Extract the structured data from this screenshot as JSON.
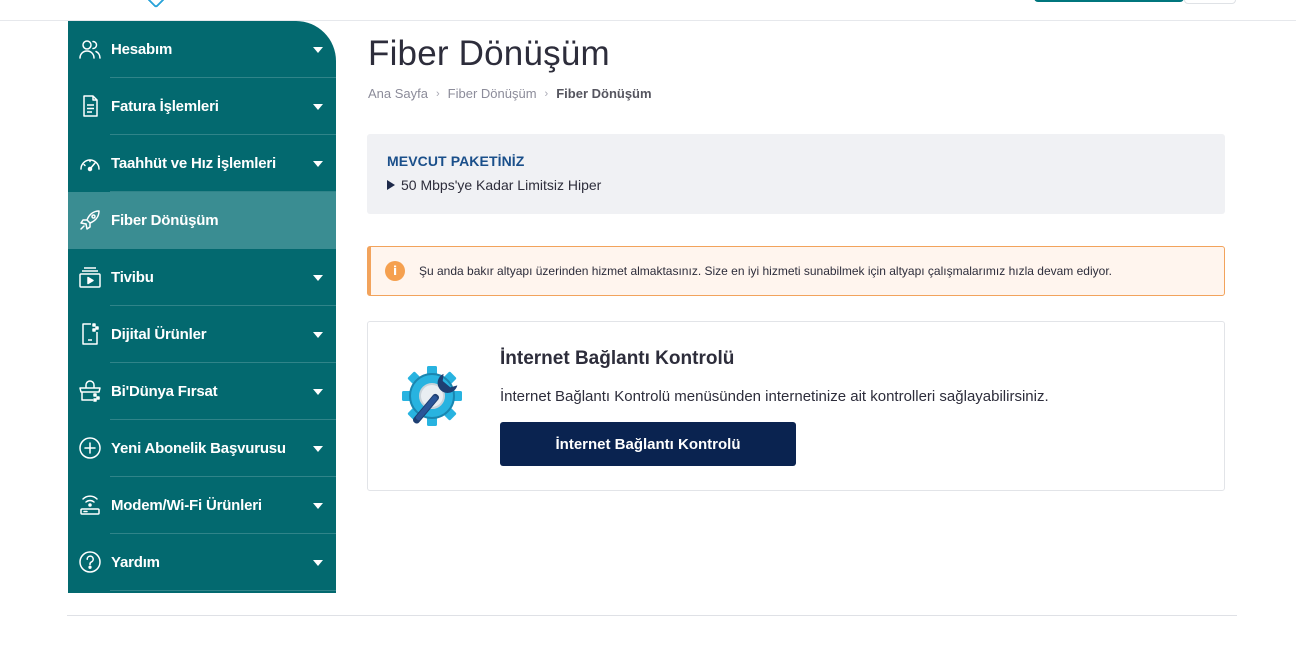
{
  "sidebar": {
    "items": [
      {
        "label": "Hesabım",
        "icon": "users-icon",
        "has_submenu": true
      },
      {
        "label": "Fatura İşlemleri",
        "icon": "document-icon",
        "has_submenu": true
      },
      {
        "label": "Taahhüt ve Hız İşlemleri",
        "icon": "speedometer-icon",
        "has_submenu": true
      },
      {
        "label": "Fiber Dönüşüm",
        "icon": "rocket-icon",
        "has_submenu": false,
        "active": true
      },
      {
        "label": "Tivibu",
        "icon": "tv-play-icon",
        "has_submenu": true
      },
      {
        "label": "Dijital Ürünler",
        "icon": "digital-device-icon",
        "has_submenu": true
      },
      {
        "label": "Bi'Dünya Fırsat",
        "icon": "shopping-basket-icon",
        "has_submenu": true
      },
      {
        "label": "Yeni Abonelik Başvurusu",
        "icon": "plus-circle-icon",
        "has_submenu": true
      },
      {
        "label": "Modem/Wi-Fi Ürünleri",
        "icon": "wifi-router-icon",
        "has_submenu": true
      },
      {
        "label": "Yardım",
        "icon": "question-circle-icon",
        "has_submenu": true
      }
    ]
  },
  "page": {
    "title": "Fiber Dönüşüm"
  },
  "breadcrumb": {
    "items": [
      "Ana Sayfa",
      "Fiber Dönüşüm",
      "Fiber Dönüşüm"
    ]
  },
  "package": {
    "title": "MEVCUT PAKETİNİZ",
    "name": "50 Mbps'ye Kadar Limitsiz Hiper"
  },
  "alert": {
    "icon_glyph": "i",
    "text": "Şu anda bakır altyapı üzerinden hizmet almaktasınız. Size en iyi hizmeti sunabilmek için altyapı çalışmalarımız hızla devam ediyor."
  },
  "connection_card": {
    "title": "İnternet Bağlantı Kontrolü",
    "description": "İnternet Bağlantı Kontrolü menüsünden internetinize ait kontrolleri sağlayabilirsiniz.",
    "button_label": "İnternet Bağlantı Kontrolü",
    "illustration": "gear-wrench-icon"
  },
  "colors": {
    "sidebar_bg": "#03696f",
    "sidebar_active": "#3a8d92",
    "primary_button": "#0a2350",
    "alert_border": "#f2a35c",
    "package_title": "#1a4f8a"
  }
}
